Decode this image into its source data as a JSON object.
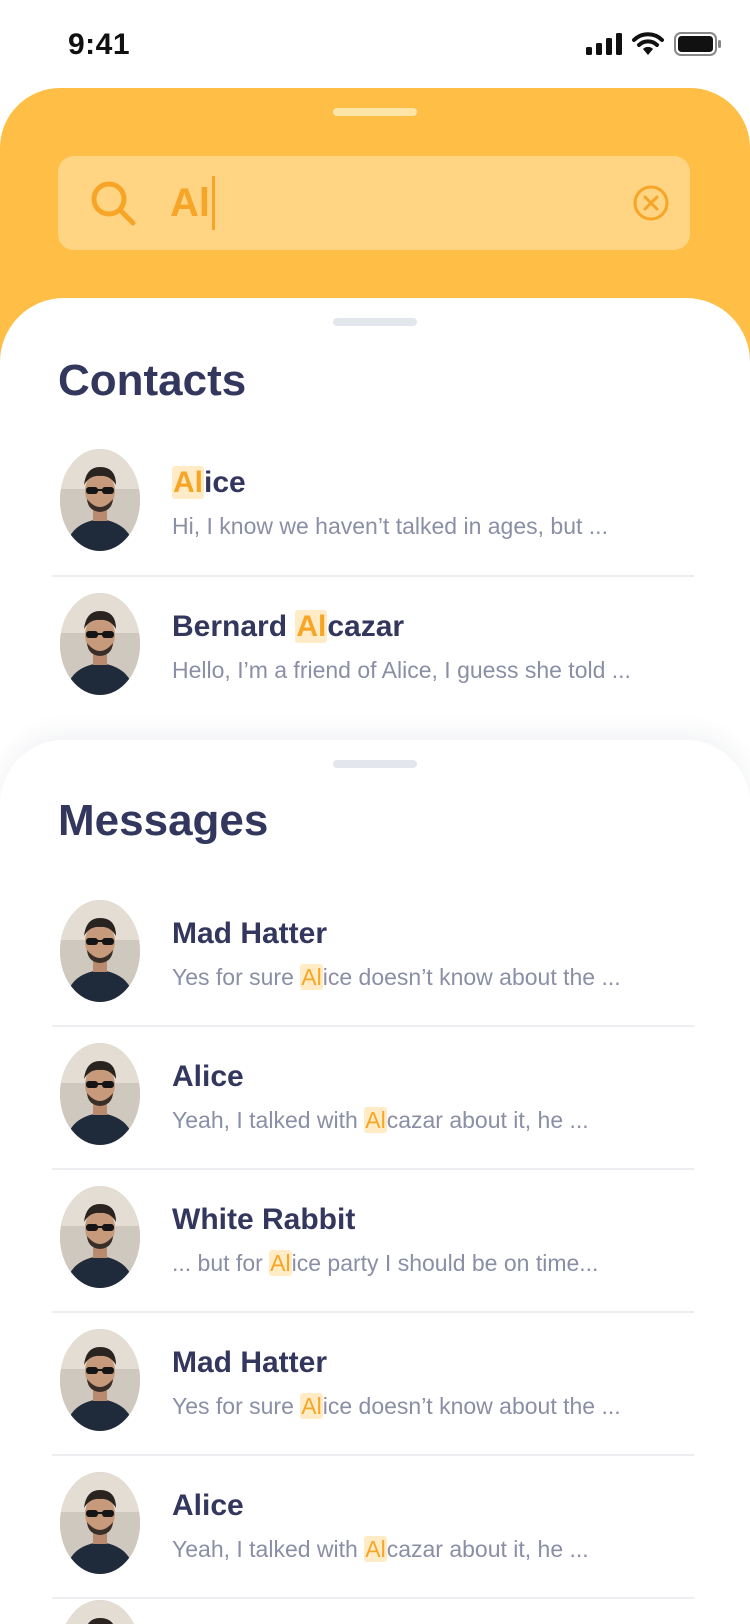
{
  "status_bar": {
    "time": "9:41"
  },
  "search": {
    "value": "Al"
  },
  "contacts": {
    "title": "Contacts",
    "items": [
      {
        "name_pre": "",
        "name_hl": "Al",
        "name_post": "ice",
        "preview_pre": "Hi, I know we haven’t talked in ages, but ...",
        "preview_hl": "",
        "preview_post": ""
      },
      {
        "name_pre": "Bernard ",
        "name_hl": "Al",
        "name_post": "cazar",
        "preview_pre": "Hello, I’m a friend of Alice, I guess she told ...",
        "preview_hl": "",
        "preview_post": ""
      }
    ]
  },
  "messages": {
    "title": "Messages",
    "items": [
      {
        "name": "Mad Hatter",
        "preview_pre": "Yes for sure ",
        "preview_hl": "Al",
        "preview_post": "ice doesn’t know about the ..."
      },
      {
        "name": "Alice",
        "preview_pre": "Yeah, I talked with ",
        "preview_hl": "Al",
        "preview_post": "cazar about it, he ..."
      },
      {
        "name": "White Rabbit",
        "preview_pre": "... but for ",
        "preview_hl": "Al",
        "preview_post": "ice party I should be on time..."
      },
      {
        "name": "Mad Hatter",
        "preview_pre": "Yes for sure ",
        "preview_hl": "Al",
        "preview_post": "ice doesn’t know about the ..."
      },
      {
        "name": "Alice",
        "preview_pre": "Yeah, I talked with ",
        "preview_hl": "Al",
        "preview_post": "cazar about it, he ..."
      }
    ]
  },
  "colors": {
    "accent": "#ffbe46",
    "highlight_text": "#f7a526",
    "highlight_bg": "#ffecc6",
    "title": "#33365d",
    "muted": "#8a8fa6"
  },
  "icons": {
    "signal": "cellular-signal-icon",
    "wifi": "wifi-icon",
    "battery": "battery-icon",
    "search": "search-icon",
    "clear": "clear-circle-icon"
  }
}
